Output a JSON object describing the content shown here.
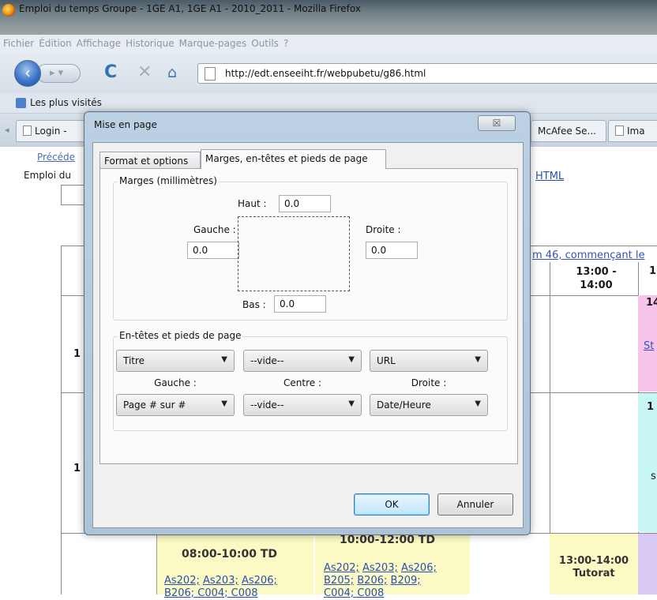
{
  "window": {
    "title": "Emploi du temps Groupe - 1GE A1, 1GE A1 - 2010_2011 - Mozilla Firefox"
  },
  "menu": [
    "Fichier",
    "Édition",
    "Affichage",
    "Historique",
    "Marque-pages",
    "Outils",
    "?"
  ],
  "nav": {
    "url": "http://edt.enseeiht.fr/webpubetu/g86.html",
    "back_icon": "back-arrow-icon",
    "forward_icon": "forward-arrow-icon",
    "reload_icon": "reload-icon",
    "stop_icon": "stop-icon",
    "home_icon": "home-icon"
  },
  "bookmarks": {
    "label": "Les plus visités"
  },
  "tabs": [
    "Login -",
    "McAfee Se...",
    "Ima"
  ],
  "page": {
    "prev_link": "Précéde",
    "emploi_label": "Emploi du",
    "html_link": "HTML",
    "week_text": "m 46, commençant le",
    "header_time": "13:00 - 14:00",
    "header_next": "1",
    "row_labels": [
      "1",
      "1"
    ],
    "pink_top": "14",
    "pink_link": "St",
    "cyan_top": "1",
    "cyan_mid": "s",
    "cell1_title": "08:00-10:00 TD",
    "cell1_rooms": [
      "As202;",
      "As203;",
      "As206;"
    ],
    "cell1_rooms2": "B206; C004; C008",
    "cell2_title": "10:00-12:00 TD",
    "cell2_rooms": [
      "As202;",
      "As203;",
      "As206;"
    ],
    "cell2_rooms2": [
      "B205;",
      "B206;",
      "B209;"
    ],
    "cell2_rooms3": "C004; C008",
    "cell3_line1": "13:00-14:00",
    "cell3_line2": "Tutorat"
  },
  "dialog": {
    "title": "Mise en page",
    "close_label": "☒",
    "tabs": {
      "format": "Format et options",
      "margins": "Marges, en-têtes et pieds de page"
    },
    "margins": {
      "legend": "Marges (millimètres)",
      "top_label": "Haut :",
      "left_label": "Gauche :",
      "right_label": "Droite :",
      "bottom_label": "Bas :",
      "top_value": "0.0",
      "left_value": "0.0",
      "right_value": "0.0",
      "bottom_value": "0.0"
    },
    "headers": {
      "legend": "En-têtes et pieds de page",
      "header_left": "Titre",
      "header_center": "--vide--",
      "header_right": "URL",
      "left_label": "Gauche :",
      "center_label": "Centre :",
      "right_label": "Droite :",
      "footer_left": "Page # sur #",
      "footer_center": "--vide--",
      "footer_right": "Date/Heure"
    },
    "buttons": {
      "ok": "OK",
      "cancel": "Annuler"
    }
  }
}
